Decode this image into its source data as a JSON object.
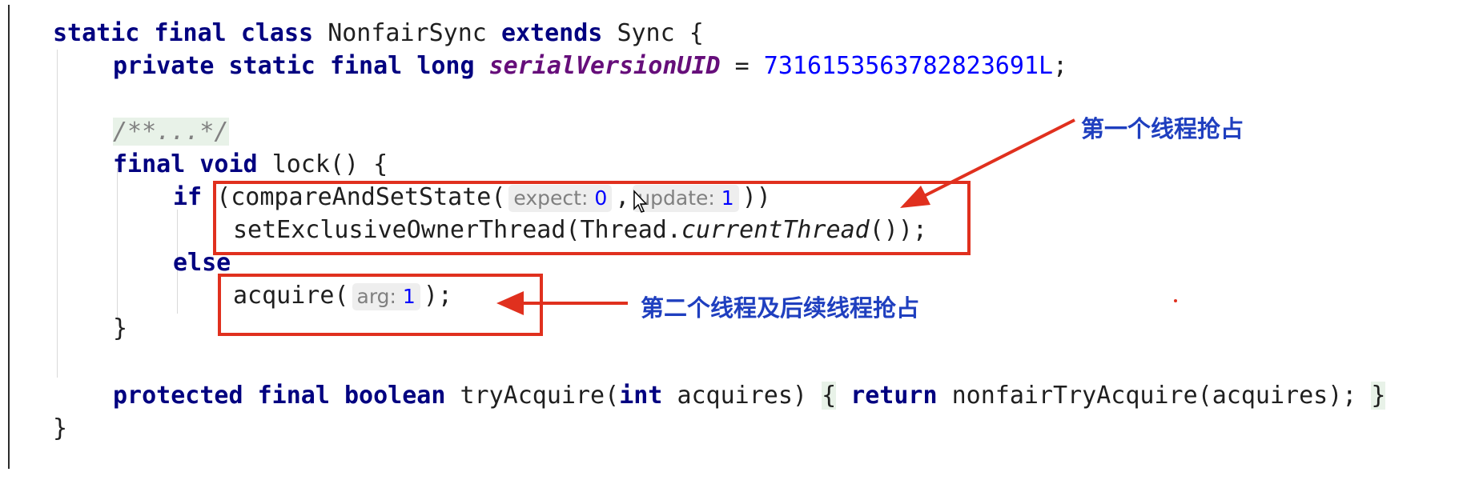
{
  "code": {
    "line1": {
      "kw_static": "static",
      "kw_final": "final",
      "kw_class": "class",
      "class_name": "NonfairSync",
      "kw_extends": "extends",
      "super_name": "Sync",
      "brace": "{"
    },
    "line2": {
      "kw_private": "private",
      "kw_static": "static",
      "kw_final": "final",
      "kw_long": "long",
      "field": "serialVersionUID",
      "eq": "=",
      "value": "7316153563782823691L",
      "semi": ";"
    },
    "line3": {
      "comment": "/**...*/"
    },
    "line4": {
      "kw_final": "final",
      "kw_void": "void",
      "method": "lock()",
      "brace": "{"
    },
    "line5": {
      "kw_if": "if",
      "open": "(compareAndSetState(",
      "hint1_label": "expect:",
      "hint1_value": "0",
      "comma": ",",
      "hint2_label": "update:",
      "hint2_value": "1",
      "close": "))"
    },
    "line6": {
      "call": "setExclusiveOwnerThread(Thread.",
      "italic_call": "currentThread",
      "close": "());"
    },
    "line7": {
      "kw_else": "else"
    },
    "line8": {
      "call": "acquire(",
      "hint_label": "arg:",
      "hint_value": "1",
      "close": ");"
    },
    "line9": {
      "brace": "}"
    },
    "line10": {
      "kw_protected": "protected",
      "kw_final": "final",
      "kw_boolean": "boolean",
      "method": "tryAcquire(",
      "kw_int": "int",
      "param": "acquires)",
      "open_brace": "{",
      "kw_return": "return",
      "body": "nonfairTryAcquire(acquires);",
      "close_brace": "}"
    },
    "line11": {
      "brace": "}"
    }
  },
  "annotations": {
    "first_thread": "第一个线程抢占",
    "second_thread": "第二个线程及后续线程抢占"
  },
  "colors": {
    "keyword": "#000080",
    "static_field": "#660e7a",
    "number": "#0000ff",
    "comment": "#808080",
    "callout": "#e0301e",
    "annotation_text": "#1f3fbf"
  }
}
